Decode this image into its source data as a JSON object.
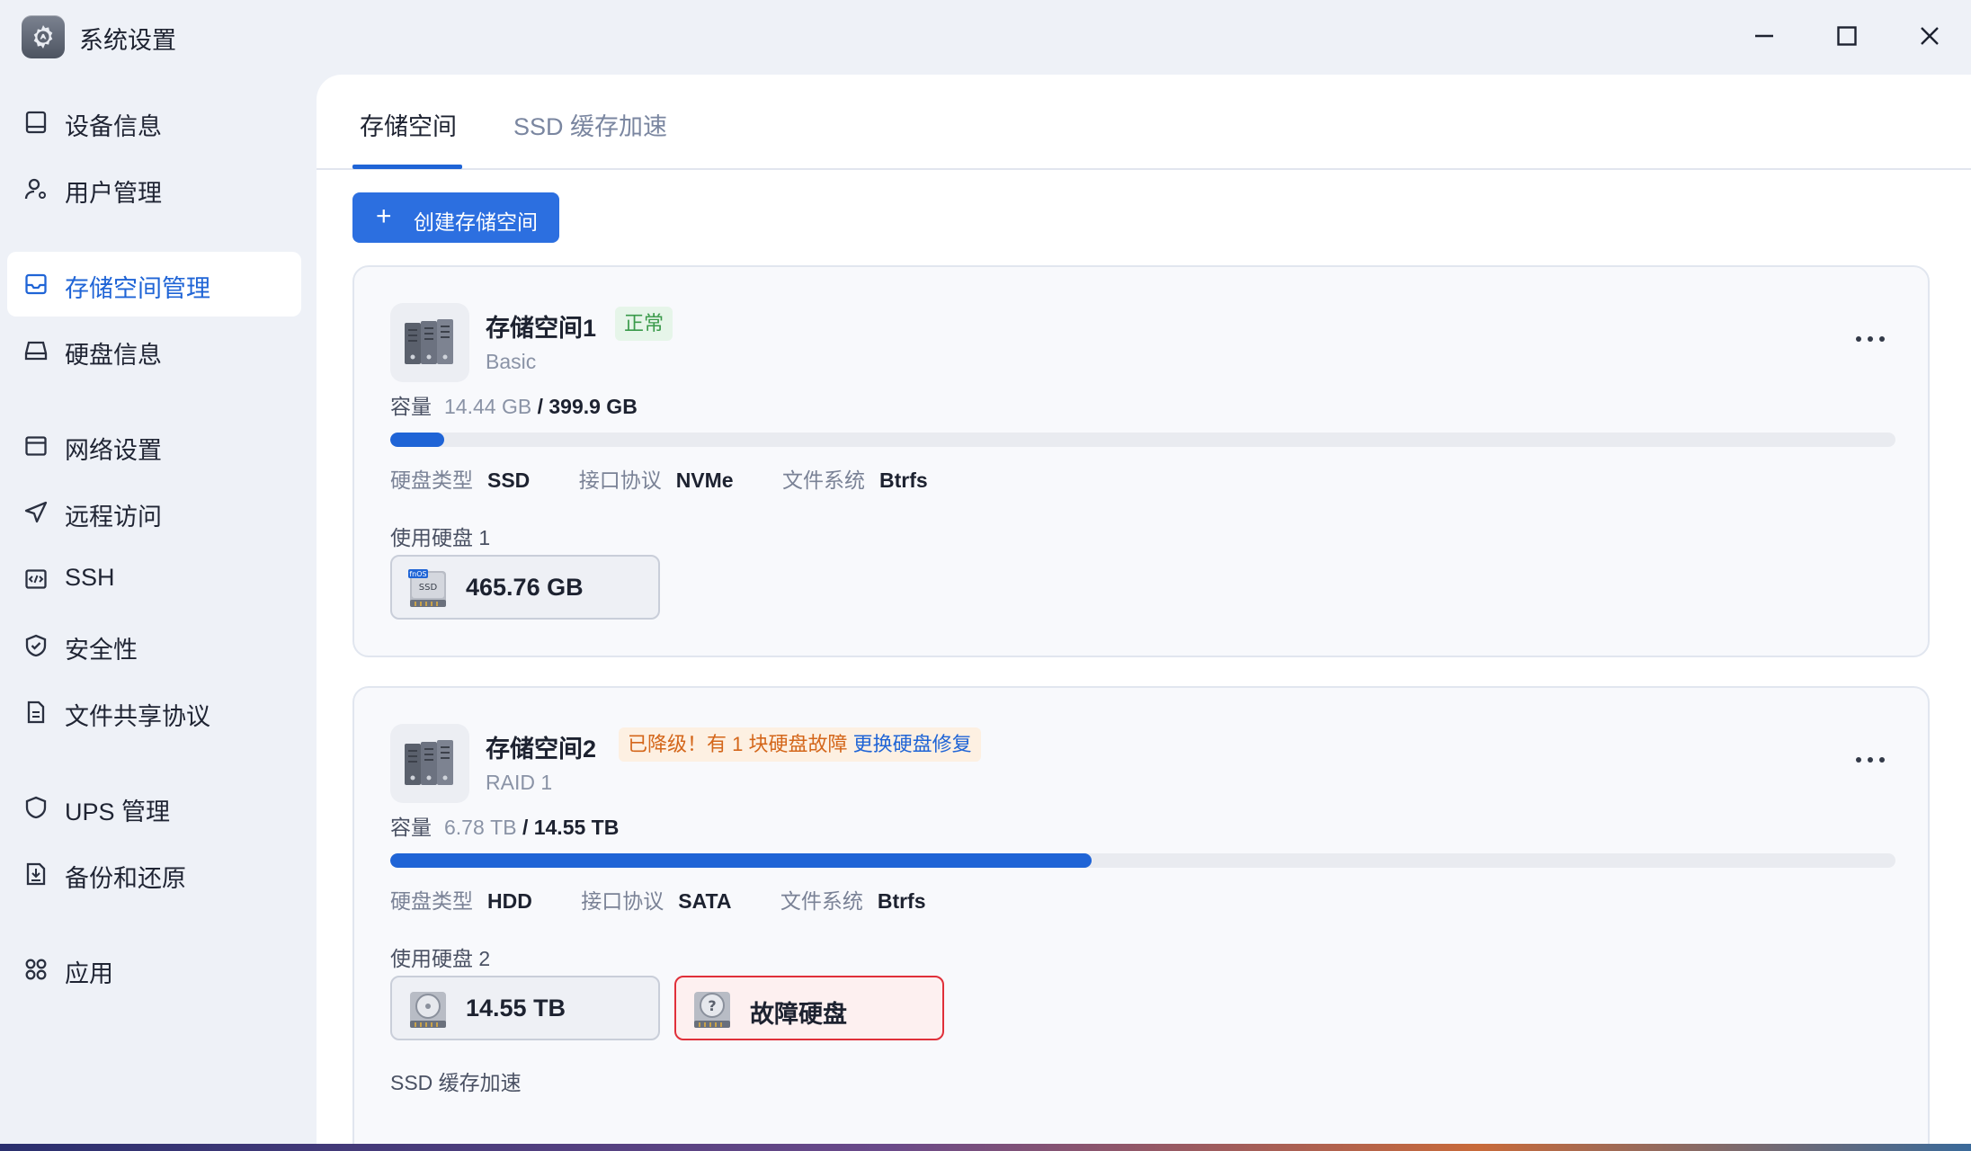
{
  "window": {
    "title": "系统设置",
    "app_icon": "settings-gear-icon",
    "controls": [
      "minimize-icon",
      "maximize-icon",
      "close-icon"
    ]
  },
  "sidebar": {
    "items": [
      {
        "label": "设备信息",
        "icon": "device-info-icon"
      },
      {
        "label": "用户管理",
        "icon": "user-icon"
      },
      {
        "label": "存储空间管理",
        "icon": "storage-icon",
        "active": true
      },
      {
        "label": "硬盘信息",
        "icon": "hard-drive-icon"
      },
      {
        "label": "网络设置",
        "icon": "network-icon"
      },
      {
        "label": "远程访问",
        "icon": "remote-access-icon"
      },
      {
        "label": "SSH",
        "icon": "code-icon"
      },
      {
        "label": "安全性",
        "icon": "shield-check-icon"
      },
      {
        "label": "文件共享协议",
        "icon": "file-share-icon"
      },
      {
        "label": "UPS 管理",
        "icon": "ups-shield-icon"
      },
      {
        "label": "备份和还原",
        "icon": "backup-icon"
      },
      {
        "label": "应用",
        "icon": "apps-icon"
      }
    ]
  },
  "tabs": [
    {
      "label": "存储空间",
      "active": true
    },
    {
      "label": "SSD 缓存加速",
      "active": false
    }
  ],
  "create_button": {
    "label": "创建存储空间",
    "icon": "plus-icon"
  },
  "pools": [
    {
      "name": "存储空间1",
      "status": "正常",
      "status_kind": "ok",
      "type": "Basic",
      "capacity_label": "容量",
      "used": "14.44 GB",
      "total": "/ 399.9 GB",
      "usage_fraction": 0.036,
      "disk_type_label": "硬盘类型",
      "disk_type": "SSD",
      "protocol_label": "接口协议",
      "protocol": "NVMe",
      "fs_label": "文件系统",
      "fs": "Btrfs",
      "disks_label": "使用硬盘 1",
      "disks": [
        {
          "size": "465.76 GB",
          "icon": "ssd-icon",
          "icon_badge": "fnOS",
          "icon_text": "SSD",
          "fault": false
        }
      ]
    },
    {
      "name": "存储空间2",
      "status": "已降级！有 1 块硬盘故障",
      "status_link": "更换硬盘修复",
      "status_kind": "warn",
      "type": "RAID 1",
      "capacity_label": "容量",
      "used": "6.78 TB",
      "total": "/ 14.55 TB",
      "usage_fraction": 0.466,
      "disk_type_label": "硬盘类型",
      "disk_type": "HDD",
      "protocol_label": "接口协议",
      "protocol": "SATA",
      "fs_label": "文件系统",
      "fs": "Btrfs",
      "disks_label": "使用硬盘 2",
      "disks": [
        {
          "size": "14.55 TB",
          "icon": "hdd-icon",
          "fault": false
        },
        {
          "size": "故障硬盘",
          "icon": "unknown-disk-icon",
          "fault": true
        }
      ],
      "ssd_cache_label": "SSD 缓存加速"
    }
  ],
  "colors": {
    "accent": "#1f64d6",
    "ok": "#3a9a4a",
    "warn": "#d4661a",
    "fault": "#e0303a"
  }
}
